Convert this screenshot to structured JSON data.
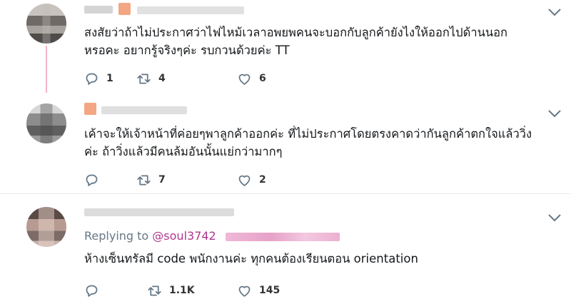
{
  "tweets": [
    {
      "text_lines": [
        "สงสัยว่าถ้าไม่ประกาศว่าไฟไหม้เวลาอพยพคนจะบอกกับลูกค้ายังไงให้ออกไปด้านนอก",
        "หรอคะ อยากรู้จริงๆค่ะ รบกวนด้วยค่ะ TT"
      ],
      "reply_count": "1",
      "retweet_count": "4",
      "like_count": "6"
    },
    {
      "text_lines": [
        "เค้าจะให้เจ้าหน้าที่ค่อยๆพาลูกค้าออกค่ะ ที่ไม่ประกาศโดยตรงคาดว่ากันลูกค้าตกใจแล้ววิ่ง",
        "ค่ะ ถ้าวิ่งแล้วมีคนล้มอันนั้นแย่กว่ามากๆ"
      ],
      "reply_count": "",
      "retweet_count": "7",
      "like_count": "2"
    },
    {
      "replying_to_label": "Replying to",
      "replying_to_handle": "@soul3742",
      "text_lines": [
        "ห้างเซ็นทรัลมี code พนักงานค่ะ ทุกคนต้องเรียนตอน orientation"
      ],
      "reply_count": "",
      "retweet_count": "1.1K",
      "like_count": "145"
    }
  ],
  "icons": {
    "reply": "reply-icon",
    "retweet": "retweet-icon",
    "like": "heart-icon",
    "more": "chevron-down-icon"
  },
  "colors": {
    "icon": "#657786",
    "thread_line": "#f2b5c6",
    "handle": "#b0358e"
  }
}
